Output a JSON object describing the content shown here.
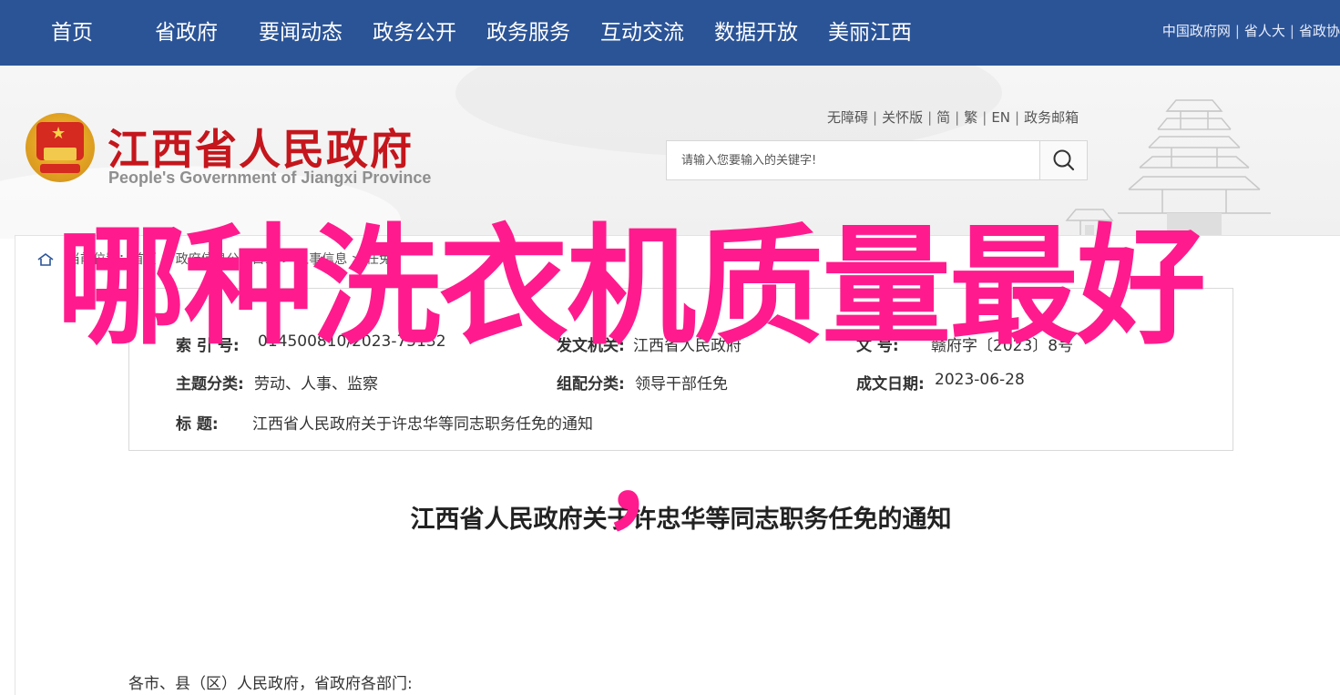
{
  "nav": {
    "items": [
      "首页",
      "省政府",
      "要闻动态",
      "政务公开",
      "政务服务",
      "互动交流",
      "数据开放",
      "美丽江西"
    ],
    "links": [
      "中国政府网",
      "省人大",
      "省政协"
    ]
  },
  "header": {
    "title": "江西省人民政府",
    "subtitle": "People's Government of Jiangxi Province",
    "util_links": [
      "无障碍",
      "关怀版",
      "简",
      "繁",
      "EN",
      "政务邮箱"
    ],
    "search_placeholder": "请输入您要输入的关键字!"
  },
  "breadcrumb": "当前位置：首页 > 政府信息公开目录 > 人事信息 > 任免",
  "info": {
    "index_label": "索  引  号:",
    "index_value": "014500810/2023-75132",
    "issuer_label": "发文机关:",
    "issuer_value": "江西省人民政府",
    "docno_label": "文    号:",
    "docno_value": "赣府字〔2023〕8号",
    "topic_label": "主题分类:",
    "topic_value": "劳动、人事、监察",
    "category_label": "组配分类:",
    "category_value": "领导干部任免",
    "date_label": "成文日期:",
    "date_value": "2023-06-28",
    "title_label": "标        题:",
    "title_value": "江西省人民政府关于许忠华等同志职务任免的通知"
  },
  "document": {
    "title": "江西省人民政府关于许忠华等同志职务任免的通知",
    "salutation": "各市、县（区）人民政府，省政府各部门:"
  },
  "overlay": {
    "headline": "哪种洗衣机质量最好",
    "mark": "，",
    "color": "#ff1b8d"
  },
  "colors": {
    "nav_bg": "#2b5497",
    "title_red": "#c4161c"
  }
}
